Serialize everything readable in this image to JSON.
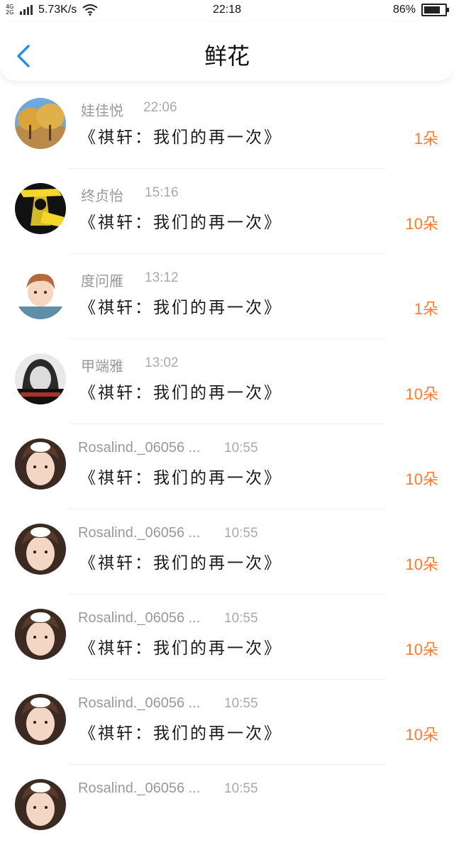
{
  "status_bar": {
    "network_label": "4G 2G",
    "speed": "5.73K/s",
    "time": "22:18",
    "battery_pct": "86%",
    "battery_level": 0.86
  },
  "header": {
    "title": "鲜花",
    "back_icon": "chevron-left-icon",
    "accent_color": "#2a8ee8"
  },
  "count_color": "#ff7a2e",
  "items": [
    {
      "name": "娃佳悦",
      "time": "22:06",
      "book": "《祺轩：我们的再一次》",
      "count": "1朵",
      "avatar": "autumn-trees"
    },
    {
      "name": "终贞怡",
      "time": "15:16",
      "book": "《祺轩：我们的再一次》",
      "count": "10朵",
      "avatar": "yellow-logo"
    },
    {
      "name": "度问雁",
      "time": "13:12",
      "book": "《祺轩：我们的再一次》",
      "count": "1朵",
      "avatar": "anime-boy"
    },
    {
      "name": "甲端雅",
      "time": "13:02",
      "book": "《祺轩：我们的再一次》",
      "count": "10朵",
      "avatar": "bw-girl"
    },
    {
      "name": "Rosalind._06056 ...",
      "time": "10:55",
      "book": "《祺轩：我们的再一次》",
      "count": "10朵",
      "avatar": "selfie-girl"
    },
    {
      "name": "Rosalind._06056 ...",
      "time": "10:55",
      "book": "《祺轩：我们的再一次》",
      "count": "10朵",
      "avatar": "selfie-girl"
    },
    {
      "name": "Rosalind._06056 ...",
      "time": "10:55",
      "book": "《祺轩：我们的再一次》",
      "count": "10朵",
      "avatar": "selfie-girl"
    },
    {
      "name": "Rosalind._06056 ...",
      "time": "10:55",
      "book": "《祺轩：我们的再一次》",
      "count": "10朵",
      "avatar": "selfie-girl"
    },
    {
      "name": "Rosalind._06056 ...",
      "time": "10:55",
      "book": "",
      "count": "",
      "avatar": "selfie-girl"
    }
  ]
}
